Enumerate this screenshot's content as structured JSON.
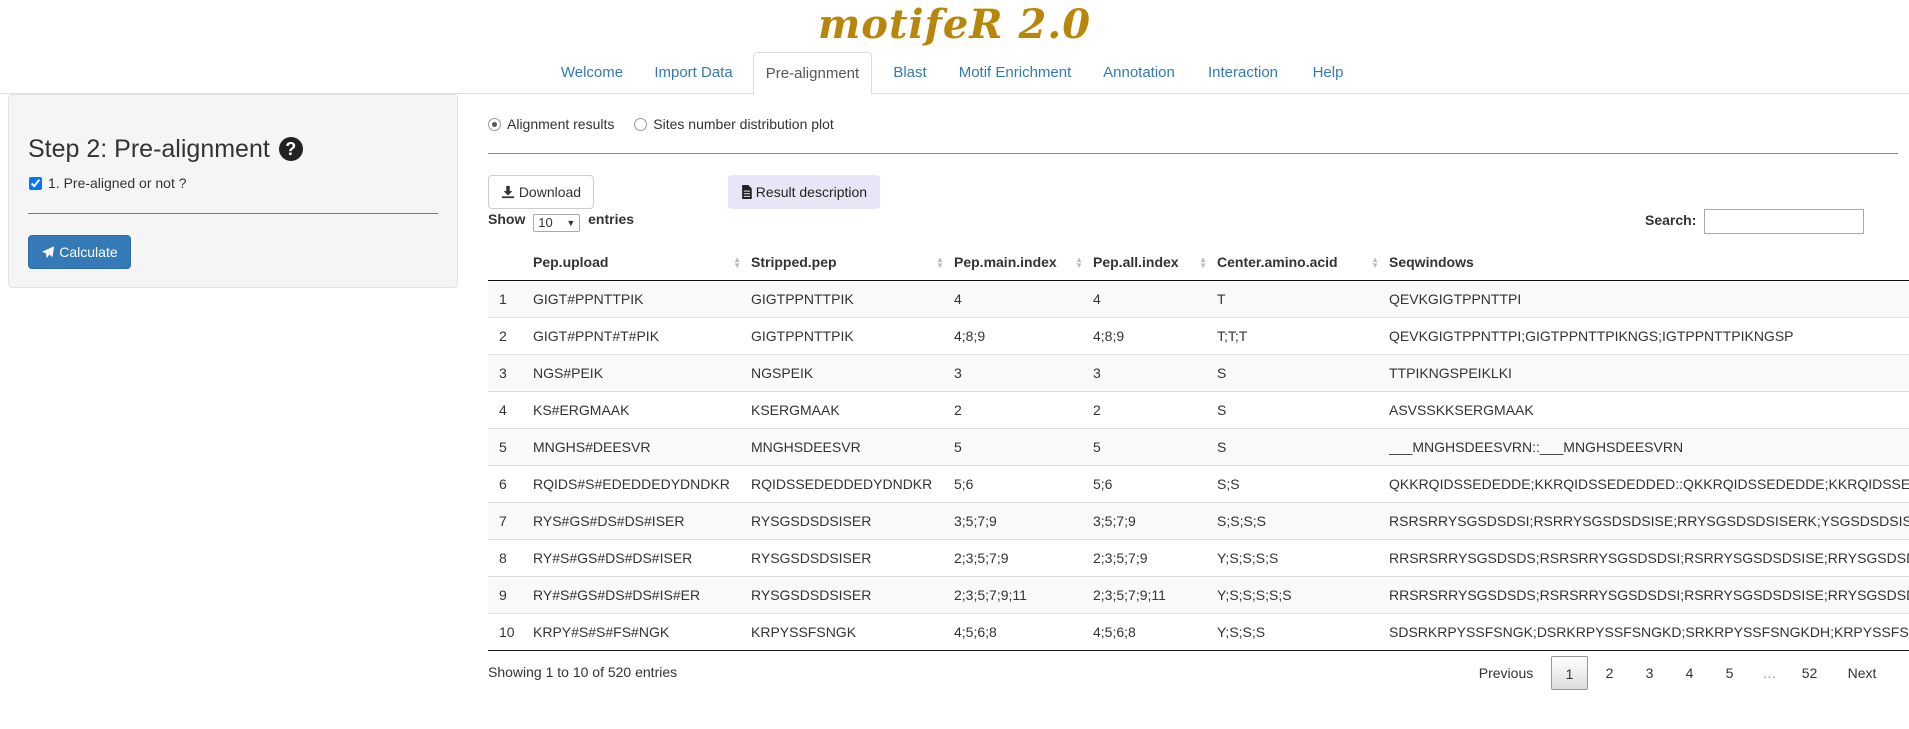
{
  "app": {
    "title": "motifeR 2.0"
  },
  "tabs": [
    {
      "label": "Welcome"
    },
    {
      "label": "Import Data"
    },
    {
      "label": "Pre-alignment"
    },
    {
      "label": "Blast"
    },
    {
      "label": "Motif Enrichment"
    },
    {
      "label": "Annotation"
    },
    {
      "label": "Interaction"
    },
    {
      "label": "Help"
    }
  ],
  "active_tab": "Pre-alignment",
  "sidebar": {
    "step_title": "Step 2: Pre-alignment",
    "help_icon": "question-circle-icon",
    "pre_aligned_label": "1. Pre-aligned or not ?",
    "pre_aligned_checked": true,
    "calculate_label": "Calculate",
    "calculate_icon": "paper-plane-icon"
  },
  "view_options": [
    {
      "label": "Alignment results",
      "selected": true
    },
    {
      "label": "Sites number distribution plot",
      "selected": false
    }
  ],
  "download_label": "Download",
  "download_icon": "download-icon",
  "result_desc_label": "Result description",
  "result_desc_icon": "file-icon",
  "table": {
    "show_label": "Show",
    "page_length": "10",
    "entries_label": "entries",
    "search_label": "Search:",
    "search_value": "",
    "columns": [
      "",
      "Pep.upload",
      "Stripped.pep",
      "Pep.main.index",
      "Pep.all.index",
      "Center.amino.acid",
      "Seqwindows"
    ],
    "rows": [
      [
        "1",
        "GIGT#PPNTTPIK",
        "GIGTPPNTTPIK",
        "4",
        "4",
        "T",
        "QEVKGIGTPPNTTPI"
      ],
      [
        "2",
        "GIGT#PPNT#T#PIK",
        "GIGTPPNTTPIK",
        "4;8;9",
        "4;8;9",
        "T;T;T",
        "QEVKGIGTPPNTTPI;GIGTPPNTTPIKNGS;IGTPPNTTPIKNGSP"
      ],
      [
        "3",
        "NGS#PEIK",
        "NGSPEIK",
        "3",
        "3",
        "S",
        "TTPIKNGSPEIKLKI"
      ],
      [
        "4",
        "KS#ERGMAAK",
        "KSERGMAAK",
        "2",
        "2",
        "S",
        "ASVSSKKSERGMAAK"
      ],
      [
        "5",
        "MNGHS#DEESVR",
        "MNGHSDEESVR",
        "5",
        "5",
        "S",
        "___MNGHSDEESVRN::___MNGHSDEESVRN"
      ],
      [
        "6",
        "RQIDS#S#EDEDDEDYDNDKR",
        "RQIDSSEDEDDEDYDNDKR",
        "5;6",
        "5;6",
        "S;S",
        "QKKRQIDSSEDEDDE;KKRQIDSSEDEDDED::QKKRQIDSSEDEDDE;KKRQIDSSEDEDDED"
      ],
      [
        "7",
        "RYS#GS#DS#DS#ISER",
        "RYSGSDSDSISER",
        "3;5;7;9",
        "3;5;7;9",
        "S;S;S;S",
        "RSRSRRYSGSDSDSI;RSRRYSGSDSDSISE;RRYSGSDSDSISERK;YSGSDSDSISERKRE"
      ],
      [
        "8",
        "RY#S#GS#DS#DS#ISER",
        "RYSGSDSDSISER",
        "2;3;5;7;9",
        "2;3;5;7;9",
        "Y;S;S;S;S",
        "RRSRSRRYSGSDSDS;RSRSRRYSGSDSDSI;RSRRYSGSDSDSISE;RRYSGSDSDSISERK"
      ],
      [
        "9",
        "RY#S#GS#DS#DS#IS#ER",
        "RYSGSDSDSISER",
        "2;3;5;7;9;11",
        "2;3;5;7;9;11",
        "Y;S;S;S;S;S",
        "RRSRSRRYSGSDSDS;RSRSRRYSGSDSDSI;RSRRYSGSDSDSISE;RRYSGSDSDSISERK"
      ],
      [
        "10",
        "KRPY#S#S#FS#NGK",
        "KRPYSSFSNGK",
        "4;5;6;8",
        "4;5;6;8",
        "Y;S;S;S",
        "SDSRKRPYSSFSNGK;DSRKRPYSSFSNGKD;SRKRPYSSFSNGKDH;KRPYSSFSNGKDHRR"
      ]
    ],
    "info": "Showing 1 to 10 of 520 entries",
    "pagination": [
      "Previous",
      "1",
      "2",
      "3",
      "4",
      "5",
      "…",
      "52",
      "Next"
    ],
    "current_page": "1"
  }
}
